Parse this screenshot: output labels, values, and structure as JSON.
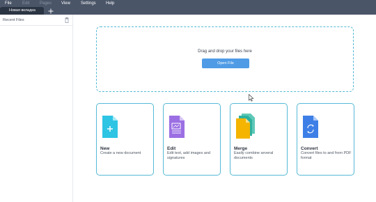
{
  "menu": {
    "items": [
      {
        "label": "File",
        "enabled": true
      },
      {
        "label": "Edit",
        "enabled": false
      },
      {
        "label": "Pages",
        "enabled": false
      },
      {
        "label": "View",
        "enabled": true
      },
      {
        "label": "Settings",
        "enabled": true
      },
      {
        "label": "Help",
        "enabled": true
      }
    ]
  },
  "tabs": {
    "active_label": "Новая вкладка",
    "add_icon": "plus-icon"
  },
  "sidebar": {
    "title": "Recent Files",
    "trash_icon": "trash-icon"
  },
  "dropzone": {
    "text": "Drag and drop your files here",
    "button_label": "Open File"
  },
  "cards": [
    {
      "title": "New",
      "description": "Create a new document",
      "icon": "new-document-icon",
      "color": "#2ec4e4"
    },
    {
      "title": "Edit",
      "description": "Edit text, add images and signatures",
      "icon": "edit-document-icon",
      "color": "#9b6fe3"
    },
    {
      "title": "Merge",
      "description": "Easily combine several documents",
      "icon": "merge-documents-icon",
      "color": "#f4b400"
    },
    {
      "title": "Convert",
      "description": "Convert files to and from PDF format",
      "icon": "convert-document-icon",
      "color": "#3d7fe6"
    }
  ],
  "colors": {
    "topbar": "#4a5568",
    "accent": "#4f9be6",
    "card_border": "#55b9d6"
  }
}
